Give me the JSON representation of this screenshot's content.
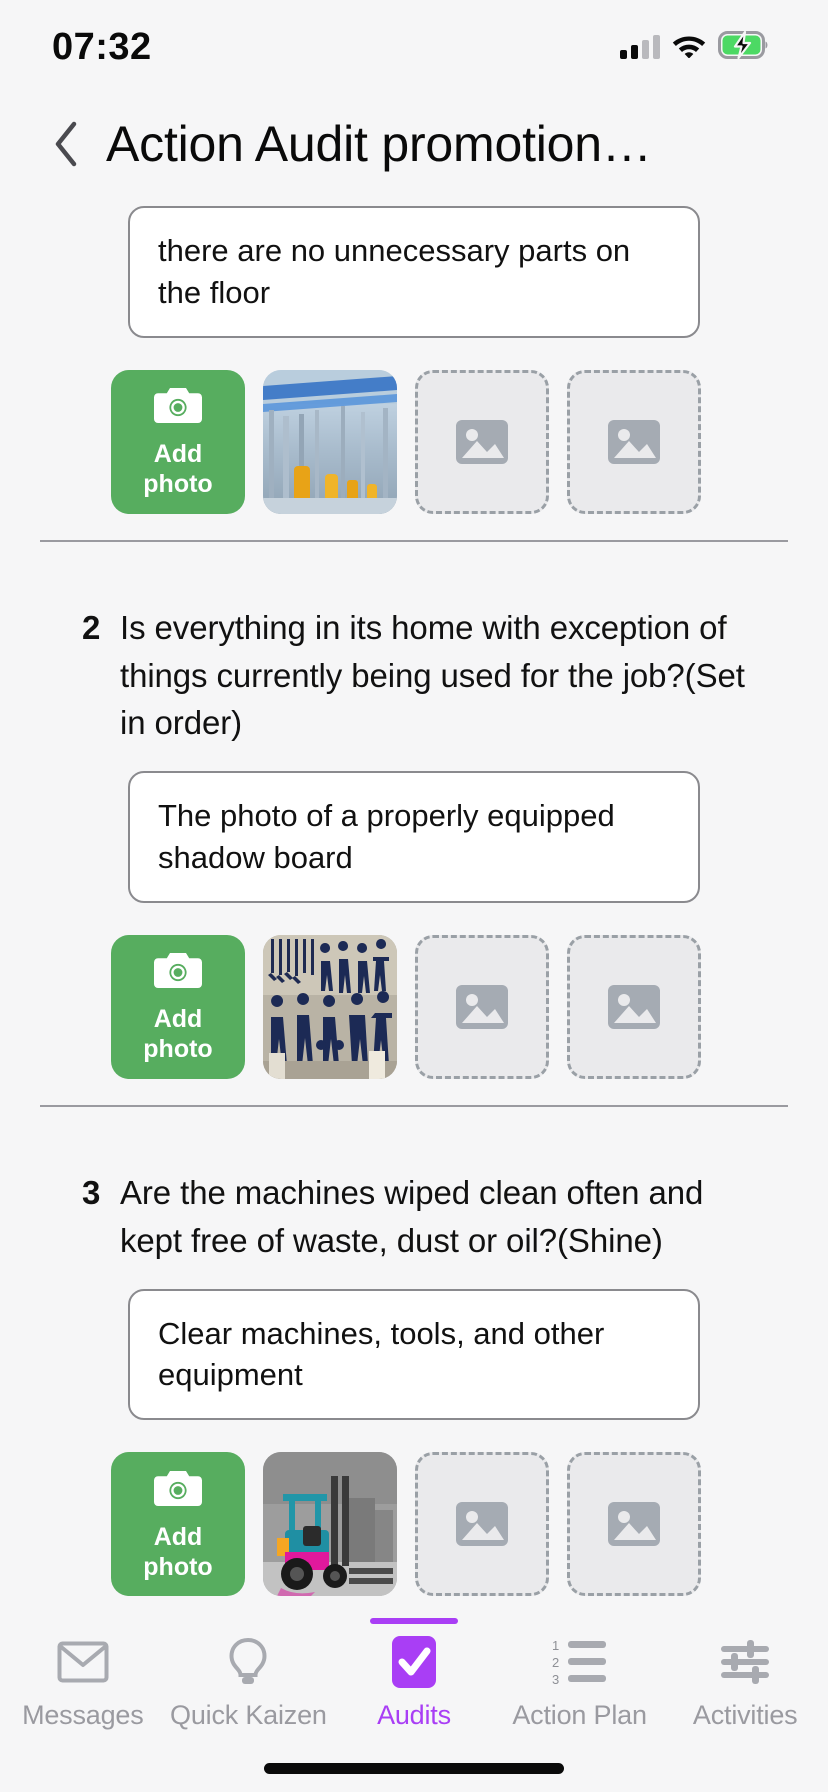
{
  "status_bar": {
    "time": "07:32",
    "signal_icon": "cellular-signal-icon",
    "wifi_icon": "wifi-icon",
    "battery_icon": "battery-charging-icon",
    "battery_color": "#4cd964"
  },
  "header": {
    "back_icon": "chevron-left-icon",
    "title": "Action Audit promotion…"
  },
  "theme": {
    "accent_purple": "#a93ef5",
    "add_photo_green": "#57ad5f",
    "page_background": "#f6f6f7",
    "inactive_gray": "#9a9aa0"
  },
  "add_photo_label_line1": "Add",
  "add_photo_label_line2": "photo",
  "camera_icon": "camera-icon",
  "placeholder_icon": "image-placeholder-icon",
  "questions": [
    {
      "number": "",
      "text": "",
      "answer": "there are no unnecessary parts on the floor",
      "photos": [
        {
          "type": "add",
          "name": "add-photo-button"
        },
        {
          "type": "image",
          "name": "photo-thumbnail-industrial-plant"
        },
        {
          "type": "empty",
          "name": "photo-slot-empty"
        },
        {
          "type": "empty",
          "name": "photo-slot-empty"
        }
      ]
    },
    {
      "number": "2",
      "text": "Is everything in its home with exception of things currently being used for the job?(Set in order)",
      "answer": "The photo of a properly equipped shadow board",
      "photos": [
        {
          "type": "add",
          "name": "add-photo-button"
        },
        {
          "type": "image",
          "name": "photo-thumbnail-shadow-board"
        },
        {
          "type": "empty",
          "name": "photo-slot-empty"
        },
        {
          "type": "empty",
          "name": "photo-slot-empty"
        }
      ]
    },
    {
      "number": "3",
      "text": "Are the machines wiped clean often and kept free of waste, dust or oil?(Shine)",
      "answer": "Clear machines, tools, and other equipment",
      "photos": [
        {
          "type": "add",
          "name": "add-photo-button"
        },
        {
          "type": "image",
          "name": "photo-thumbnail-forklift"
        },
        {
          "type": "empty",
          "name": "photo-slot-empty"
        },
        {
          "type": "empty",
          "name": "photo-slot-empty"
        }
      ]
    }
  ],
  "tabs": [
    {
      "label": "Messages",
      "icon": "envelope-icon",
      "active": false
    },
    {
      "label": "Quick Kaizen",
      "icon": "lightbulb-icon",
      "active": false
    },
    {
      "label": "Audits",
      "icon": "checkbox-check-icon",
      "active": true
    },
    {
      "label": "Action Plan",
      "icon": "numbered-list-icon",
      "active": false
    },
    {
      "label": "Activities",
      "icon": "sliders-icon",
      "active": false
    }
  ]
}
